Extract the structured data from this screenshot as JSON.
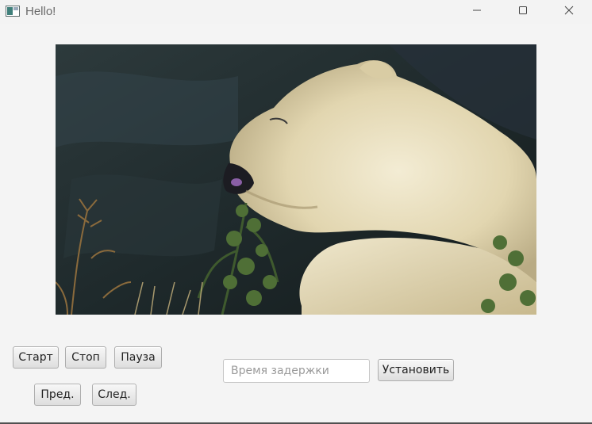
{
  "window": {
    "title": "Hello!"
  },
  "icons": {
    "app": "app-window-icon",
    "minimize": "minimize-icon",
    "maximize": "maximize-icon",
    "close": "close-icon"
  },
  "image": {
    "subject": "polar-bear-photo"
  },
  "controls": {
    "start_label": "Старт",
    "stop_label": "Стоп",
    "pause_label": "Пауза",
    "prev_label": "Пред.",
    "next_label": "След."
  },
  "delay": {
    "placeholder": "Время задержки",
    "value": "",
    "set_label": "Установить"
  }
}
